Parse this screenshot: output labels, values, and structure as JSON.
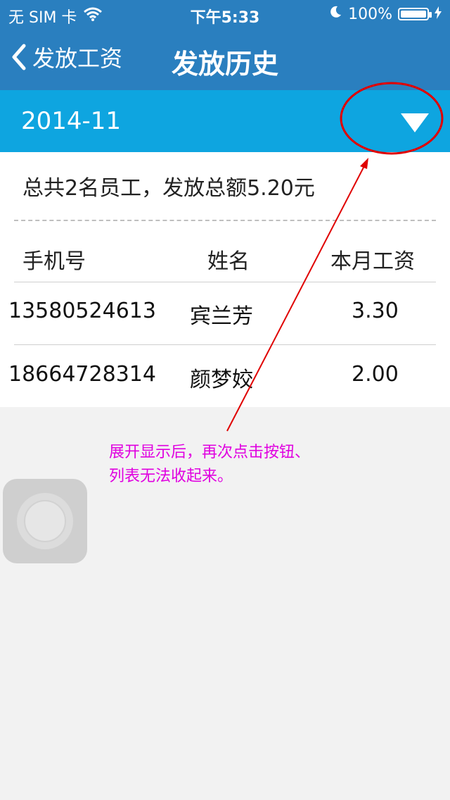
{
  "status_bar": {
    "carrier": "无 SIM 卡",
    "time": "下午5:33",
    "battery_percent": "100%",
    "battery_level": 1.0,
    "icons": [
      "wifi-icon",
      "moon-icon",
      "battery-icon"
    ]
  },
  "nav": {
    "back_label": "发放工资",
    "title": "发放历史"
  },
  "month_selector": {
    "value": "2014-11",
    "toggle_icon": "triangle-down-icon"
  },
  "summary": "总共2名员工，发放总额5.20元",
  "table": {
    "headers": [
      "手机号",
      "姓名",
      "本月工资"
    ],
    "rows": [
      {
        "phone": "13580524613",
        "name": "宾兰芳",
        "salary": "3.30"
      },
      {
        "phone": "18664728314",
        "name": "颜梦姣",
        "salary": "2.00"
      }
    ]
  },
  "annotation": {
    "line1": "展开显示后，再次点击按钮、",
    "line2": "列表无法收起来。",
    "color": "#e000e0",
    "circle_color": "#e00000"
  },
  "colors": {
    "nav_bg": "#2a7fbf",
    "month_bg": "#0ea5e0",
    "background": "#f2f2f2"
  }
}
